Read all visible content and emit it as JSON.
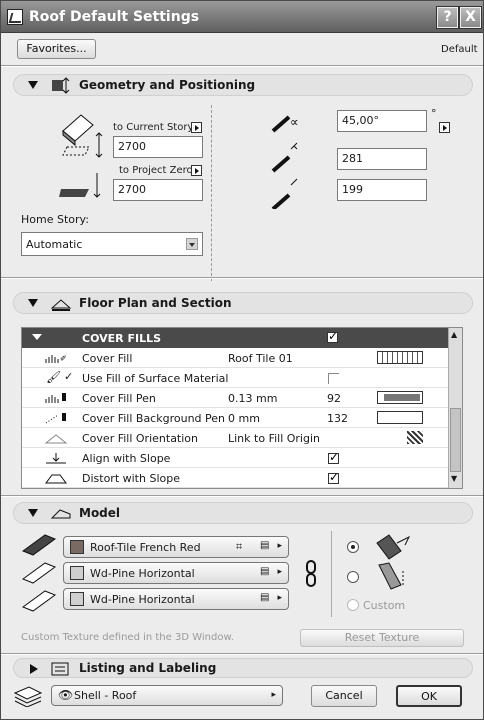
{
  "window": {
    "title": "Roof Default Settings",
    "help_button": "?",
    "close_button": "X"
  },
  "toolbar": {
    "favorites_label": "Favorites...",
    "default_label": "Default"
  },
  "geometry": {
    "header": "Geometry and Positioning",
    "to_current_story_label": "to Current Story",
    "current_story_value": "2700",
    "to_project_zero_label": "to Project Zero",
    "project_zero_value": "2700",
    "home_story_label": "Home Story:",
    "home_story_value": "Automatic",
    "angle_value": "45,00°",
    "degree_symbol": "°",
    "thickness_value": "281",
    "height_value": "199"
  },
  "floor_plan": {
    "header": "Floor Plan and Section",
    "group_title": "COVER FILLS",
    "rows": [
      {
        "label": "Cover Fill",
        "value": "Roof Tile 01",
        "num": ""
      },
      {
        "label": "Use Fill of Surface Material",
        "value": "",
        "num": ""
      },
      {
        "label": "Cover Fill Pen",
        "value": "0.13 mm",
        "num": "92"
      },
      {
        "label": "Cover Fill Background Pen",
        "value": "0 mm",
        "num": "132"
      },
      {
        "label": "Cover Fill Orientation",
        "value": "Link to Fill Origin",
        "num": ""
      },
      {
        "label": "Align with Slope",
        "value": "",
        "num": ""
      },
      {
        "label": "Distort with Slope",
        "value": "",
        "num": ""
      }
    ]
  },
  "model": {
    "header": "Model",
    "materials": [
      {
        "name": "Roof-Tile French Red",
        "color": "#7a6a64"
      },
      {
        "name": "Wd-Pine Horizontal",
        "color": "#cfcfcf"
      },
      {
        "name": "Wd-Pine Horizontal",
        "color": "#cfcfcf"
      }
    ],
    "custom_label": "Custom",
    "custom_texture_note": "Custom Texture defined in the 3D Window.",
    "reset_texture_label": "Reset Texture"
  },
  "listing": {
    "header": "Listing and Labeling"
  },
  "footer": {
    "layer_value": "Shell - Roof",
    "cancel_label": "Cancel",
    "ok_label": "OK"
  }
}
